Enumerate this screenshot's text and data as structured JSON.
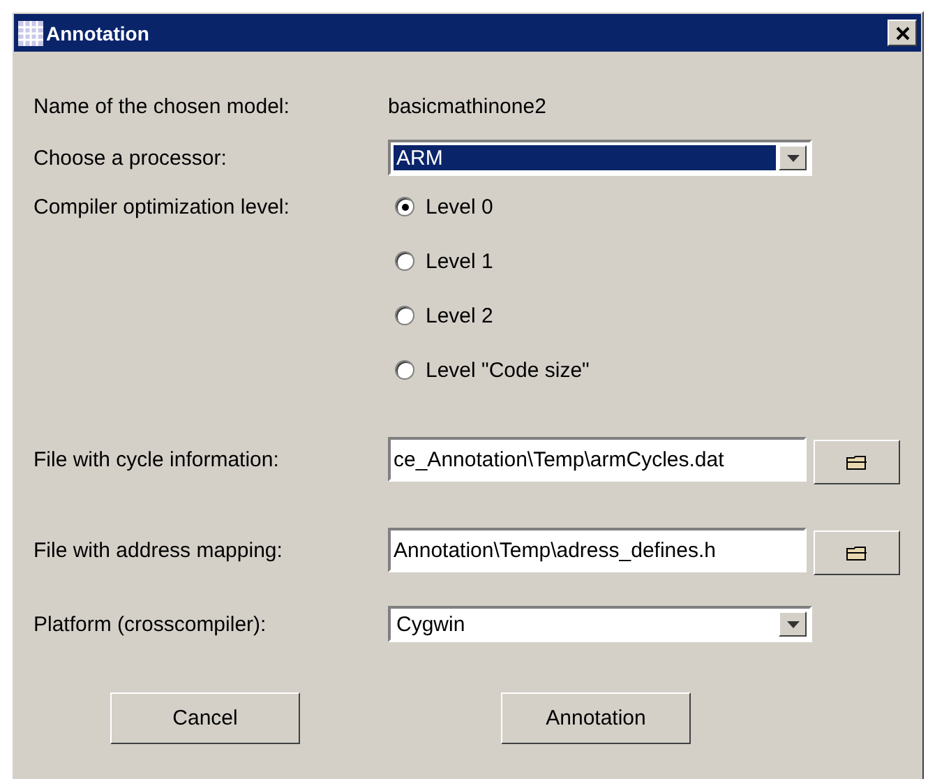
{
  "window": {
    "title": "Annotation"
  },
  "model": {
    "label": "Name of the chosen model:",
    "value": "basicmathinone2"
  },
  "processor": {
    "label": "Choose a processor:",
    "value": "ARM",
    "focused": true
  },
  "optimization": {
    "label": "Compiler optimization level:",
    "options": [
      {
        "label": "Level 0",
        "selected": true
      },
      {
        "label": "Level 1",
        "selected": false
      },
      {
        "label": "Level 2",
        "selected": false
      },
      {
        "label": "Level \"Code size\"",
        "selected": false
      }
    ]
  },
  "files": [
    {
      "label": "File with cycle information:",
      "value": "ce_Annotation\\Temp\\armCycles.dat"
    },
    {
      "label": "File with address mapping:",
      "value": "Annotation\\Temp\\adress_defines.h"
    }
  ],
  "platform": {
    "label": "Platform (crosscompiler):",
    "value": "Cygwin",
    "focused": false
  },
  "buttons": [
    "Cancel",
    "Annotation"
  ]
}
